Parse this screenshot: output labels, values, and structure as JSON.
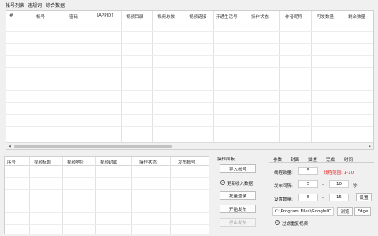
{
  "menu": {
    "items": [
      "帐号列表",
      "违规词",
      "综合数据"
    ]
  },
  "account_grid": {
    "columns": [
      "#",
      "帐号",
      "密码",
      "[APPID]",
      "视频目录",
      "视频总数",
      "视频链接",
      "开通生活号",
      "操作状态",
      "作者昵称",
      "可发数量",
      "剩余数量"
    ]
  },
  "video_grid": {
    "columns": [
      "序号",
      "视频标题",
      "视频地址",
      "视频封面",
      "操作状态",
      "发布帐号"
    ]
  },
  "ops_panel": {
    "title": "操作面板",
    "import_label": "导入帐号",
    "update_label": "更新收入数据",
    "batch_login_label": "批量登录",
    "start_publish_label": "开始发布",
    "stop_publish_label": "停止发布"
  },
  "settings": {
    "tabs": [
      "参数",
      "封面",
      "描述",
      "完成",
      "时间"
    ],
    "thread_label": "线程数量:",
    "thread_value": "5",
    "thread_range": "线程范围: 1-10",
    "interval_label": "发布间隔:",
    "interval_min": "5",
    "dash1": "-",
    "interval_max": "10",
    "interval_unit": "秒",
    "count_label": "设置数量:",
    "count_min": "5",
    "dash2": "-",
    "count_max": "15",
    "set_label": "设置",
    "path_value": "C:\\Program Files\\Google\\C",
    "browse_label": "浏览",
    "edge_label": "Edge",
    "dedupe_label": "过滤重复视频"
  },
  "colors": {
    "accent_red": "#e02020"
  }
}
